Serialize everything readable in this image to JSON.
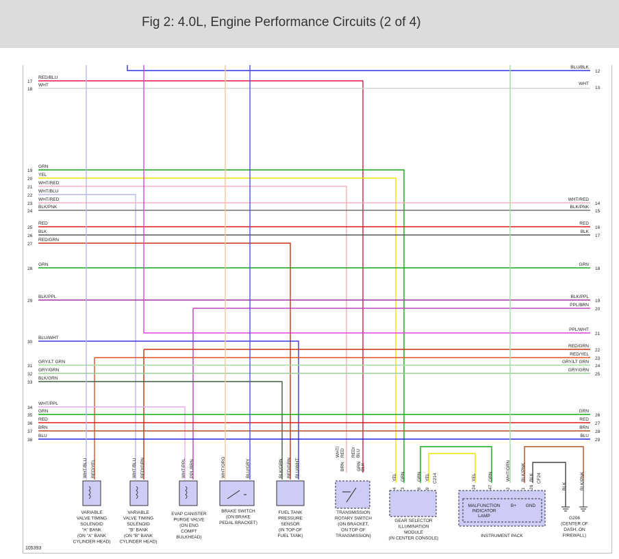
{
  "header": {
    "title": "Fig 2: 4.0L, Engine Performance Circuits (2 of 4)"
  },
  "figure_number": "105393",
  "left_rows": [
    {
      "num": "17",
      "label": "RED/BLU",
      "color": "#e8174a"
    },
    {
      "num": "18",
      "label": "WHT",
      "color": "#d8d8d8"
    },
    {
      "num": "19",
      "label": "GRN",
      "color": "#12a812"
    },
    {
      "num": "20",
      "label": "YEL",
      "color": "#f0e000"
    },
    {
      "num": "21",
      "label": "WHT/RED",
      "color": "#f0a8b0"
    },
    {
      "num": "22",
      "label": "WHT/BLU",
      "color": "#b0b0f0"
    },
    {
      "num": "23",
      "label": "WHT/RED",
      "color": "#f0a8b0"
    },
    {
      "num": "24",
      "label": "BLK/PNK",
      "color": "#707070"
    },
    {
      "num": "25",
      "label": "RED",
      "color": "#e01818"
    },
    {
      "num": "26",
      "label": "BLK",
      "color": "#606060"
    },
    {
      "num": "27",
      "label": "RED/GRN",
      "color": "#c83010"
    },
    {
      "num": "28",
      "label": "GRN",
      "color": "#12a812"
    },
    {
      "num": "29",
      "label": "BLK/PPL",
      "color": "#a030a0"
    },
    {
      "num": "30",
      "label": "BLU/WHT",
      "color": "#3838e0"
    },
    {
      "num": "31",
      "label": "GRY/LT GRN",
      "color": "#a0d8a0"
    },
    {
      "num": "32",
      "label": "GRY/GRN",
      "color": "#90c890"
    },
    {
      "num": "33",
      "label": "BLK/GRN",
      "color": "#406040"
    },
    {
      "num": "34",
      "label": "WHT/PPL",
      "color": "#e8a0e8"
    },
    {
      "num": "35",
      "label": "GRN",
      "color": "#12a812"
    },
    {
      "num": "36",
      "label": "RED",
      "color": "#e01818"
    },
    {
      "num": "37",
      "label": "BRN",
      "color": "#b05020"
    },
    {
      "num": "38",
      "label": "BLU",
      "color": "#2020e0"
    }
  ],
  "right_rows": [
    {
      "num": "12",
      "label": "BLU/BLK"
    },
    {
      "num": "13",
      "label": "WHT"
    },
    {
      "num": "14",
      "label": "WHT/RED"
    },
    {
      "num": "15",
      "label": "BLK/PNK"
    },
    {
      "num": "16",
      "label": "RED"
    },
    {
      "num": "17",
      "label": "BLK"
    },
    {
      "num": "18",
      "label": "GRN"
    },
    {
      "num": "19",
      "label": "BLK/PPL"
    },
    {
      "num": "20",
      "label": "PPL/BRN"
    },
    {
      "num": "21",
      "label": "PPL/WHT"
    },
    {
      "num": "22",
      "label": "RED/GRN"
    },
    {
      "num": "23",
      "label": "RED/YEL"
    },
    {
      "num": "24",
      "label": "GRY/LT GRN"
    },
    {
      "num": "25",
      "label": "GRY/GRN"
    },
    {
      "num": "26",
      "label": "GRN"
    },
    {
      "num": "27",
      "label": "RED"
    },
    {
      "num": "28",
      "label": "BRN"
    },
    {
      "num": "29",
      "label": "BLU"
    }
  ],
  "components": [
    {
      "pins": [
        {
          "n": "2",
          "w": "WHT/BLU"
        },
        {
          "n": "1",
          "w": "RED/YEL"
        }
      ],
      "lines": [
        "VARIABLE",
        "VALVE TIMING",
        "SOLENOID",
        "\"A\" BANK",
        "(ON \"A\" BANK",
        "CYLINDER HEAD)"
      ]
    },
    {
      "pins": [
        {
          "n": "2",
          "w": "WHT/BLU"
        },
        {
          "n": "1",
          "w": "RED/GRN"
        }
      ],
      "lines": [
        "VARIABLE",
        "VALVE TIMING",
        "SOLENOID",
        "\"B\" BANK",
        "(ON \"B\" BANK",
        "CYLINDER HEAD)"
      ]
    },
    {
      "pins": [
        {
          "n": "1",
          "w": "WHT/PPL"
        },
        {
          "n": "2",
          "w": "PPL/BRN"
        }
      ],
      "lines": [
        "EVAP CANISTER",
        "PURGE VALVE",
        "(ON ENG",
        "COMPT",
        "BULKHEAD)"
      ]
    },
    {
      "pins": [
        {
          "n": "4",
          "w": "WHT/ORG"
        },
        {
          "n": "1",
          "w": "BLU/GRY"
        }
      ],
      "lines": [
        "BRAKE SWITCH",
        "(ON BRAKE",
        "PEDAL BRACKET)"
      ]
    },
    {
      "pins": [
        {
          "n": "1",
          "w": "BLK/GRN"
        },
        {
          "n": "2",
          "w": "RED/GRN"
        },
        {
          "n": "3",
          "w": "BLU/WHT"
        }
      ],
      "lines": [
        "FUEL TANK",
        "PRESSURE",
        "SENSOR",
        "(IN TOP OF",
        "FUEL TANK)"
      ]
    },
    {
      "pins": [
        {
          "n": "",
          "w": "BRN"
        },
        {
          "n": "",
          "w": "GRN"
        },
        {
          "n": "",
          "w": "BLK"
        }
      ],
      "top_labels": [
        "WHT/",
        "RED",
        "RED/",
        "BLU"
      ],
      "lines": [
        "TRANSMISSION",
        "ROTARY SWITCH",
        "(ON BRACKET,",
        "ON TOP OF",
        "TRANSMISSION)"
      ]
    },
    {
      "pins": [
        {
          "n": "4",
          "w": "YEL"
        },
        {
          "n": "3",
          "w": "GRN"
        },
        {
          "n": "8",
          "w": "GRN"
        },
        {
          "n": "9",
          "w": "YEL"
        }
      ],
      "connector": "C214",
      "lines": [
        "GEAR SELECTOR",
        "ILLUMINATION",
        "MODULE",
        "(IN CENTER CONSOLE)"
      ]
    },
    {
      "pins": [
        {
          "n": "24",
          "w": "YEL"
        },
        {
          "n": "47",
          "w": "GRN"
        },
        {
          "n": "2",
          "w": "WHT/GRN"
        },
        {
          "n": "1",
          "w": "BLK/PNK"
        },
        {
          "n": "26",
          "w": "BLK"
        }
      ],
      "connector": "CF24",
      "inner": [
        "MALFUNCTION",
        "INDICATOR",
        "LAMP"
      ],
      "inner_pins": [
        "B+",
        "GND"
      ],
      "lines": [
        "INSTRUMENT PACK"
      ]
    },
    {
      "wires": [
        "BLK",
        "BLK/PNK"
      ],
      "lines": [
        "G206",
        "(CENTER OF",
        "DASH, ON",
        "FIREWALL)"
      ]
    }
  ]
}
